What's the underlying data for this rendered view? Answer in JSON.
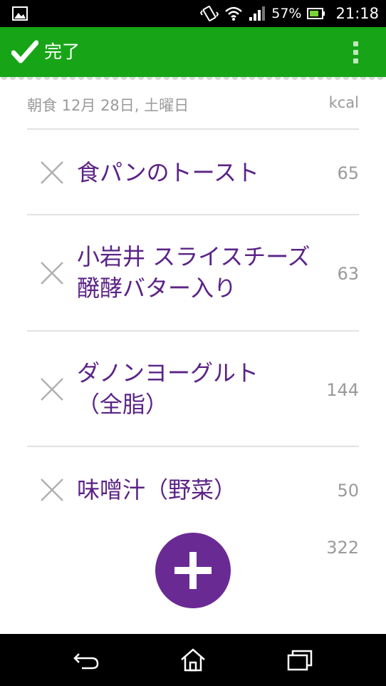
{
  "status_bar": {
    "battery_percent": "57%",
    "time": "21:18",
    "icons": [
      "image-icon",
      "vibrate-icon",
      "wifi-icon",
      "signal-icon",
      "battery-icon"
    ]
  },
  "action_bar": {
    "done_label": "完了",
    "accent_color": "#17a517"
  },
  "meal": {
    "title": "朝食 12月 28日, 土曜日",
    "kcal_header": "kcal",
    "items": [
      {
        "name": "食パンのトースト",
        "kcal": "65"
      },
      {
        "name": "小岩井 スライスチーズ醗酵バター入り",
        "kcal": "63"
      },
      {
        "name": "ダノンヨーグルト（全脂）",
        "kcal": "144"
      },
      {
        "name": "味噌汁（野菜）",
        "kcal": "50"
      }
    ],
    "total_kcal": "322"
  },
  "colors": {
    "food_name": "#5b2386",
    "add_button": "#6a2a93",
    "secondary_text": "#9a9a9a"
  }
}
